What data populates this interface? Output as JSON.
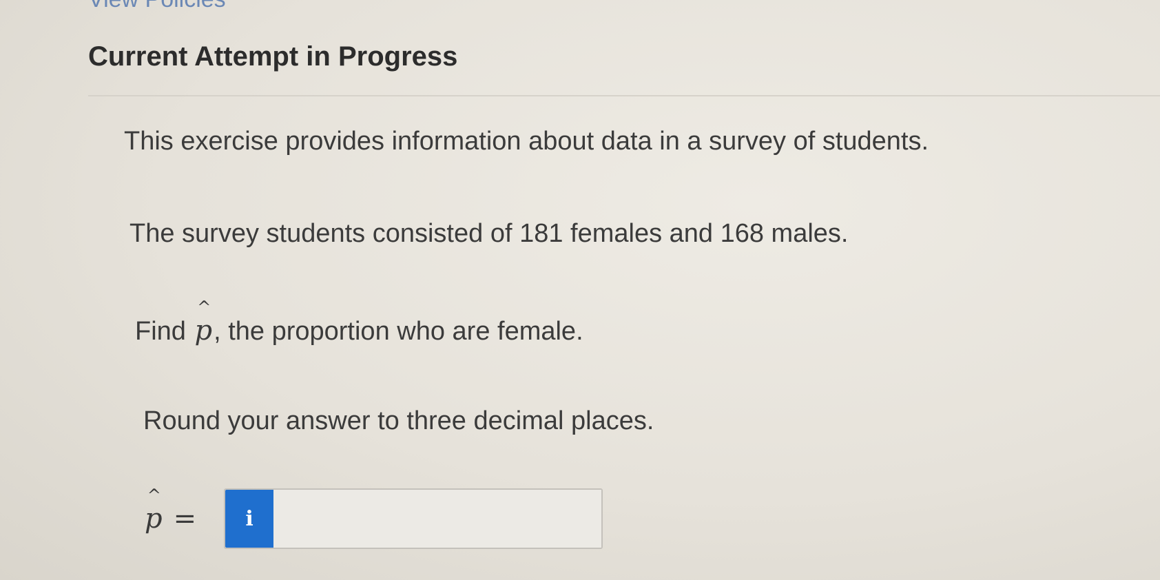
{
  "header": {
    "link_text": "View Policies",
    "section_title": "Current Attempt in Progress"
  },
  "question": {
    "intro": "This exercise provides information about data in a survey of students.",
    "data_statement": "The survey students consisted of 181 females and 168 males.",
    "prompt_before": "Find ",
    "prompt_symbol": "p",
    "prompt_after": ", the proportion who are female.",
    "rounding": "Round your answer to three decimal places."
  },
  "answer": {
    "symbol": "p",
    "equals": "=",
    "info_icon_glyph": "i",
    "info_icon_name": "info-icon",
    "info_color": "#1f6fce",
    "input_value": "",
    "input_placeholder": ""
  }
}
